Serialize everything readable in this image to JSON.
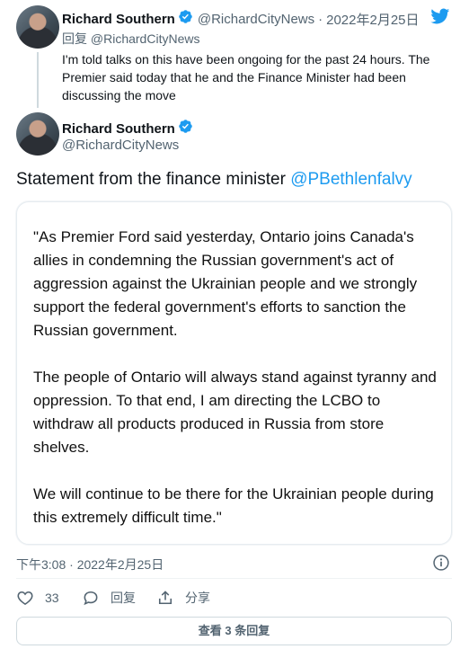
{
  "reply_tweet": {
    "author_name": "Richard Southern",
    "author_handle": "@RichardCityNews",
    "separator": "·",
    "date": "2022年2月25日",
    "reply_prefix": "回复",
    "reply_to": "@RichardCityNews",
    "text": "I'm told talks on this have been ongoing for the past 24 hours. The Premier said today that he and the Finance Minister had been discussing the move"
  },
  "main_tweet": {
    "author_name": "Richard Southern",
    "author_handle": "@RichardCityNews",
    "text": "Statement from the finance minister",
    "mention": "@PBethlenfalvy",
    "image_paragraphs": [
      "\"As Premier Ford said yesterday, Ontario joins Canada's allies in condemning the Russian government's act of aggression against the Ukrainian people and we strongly support the federal government's efforts to sanction the Russian government.",
      "The people of Ontario will always stand against tyranny and oppression. To that end, I am directing the LCBO to withdraw all products produced in Russia from store shelves.",
      "We will continue to be there for the Ukrainian people during this extremely difficult time.\""
    ],
    "timestamp": "下午3:08 · 2022年2月25日",
    "likes": "33",
    "reply_label": "回复",
    "share_label": "分享",
    "more_replies": "查看 3 条回复"
  },
  "colors": {
    "twitter_blue": "#1d9bf0",
    "text": "#0f1419",
    "muted": "#536471"
  },
  "icons": [
    "twitter-bird-icon",
    "verified-badge-icon",
    "info-icon",
    "heart-icon",
    "reply-bubble-icon",
    "share-icon"
  ]
}
